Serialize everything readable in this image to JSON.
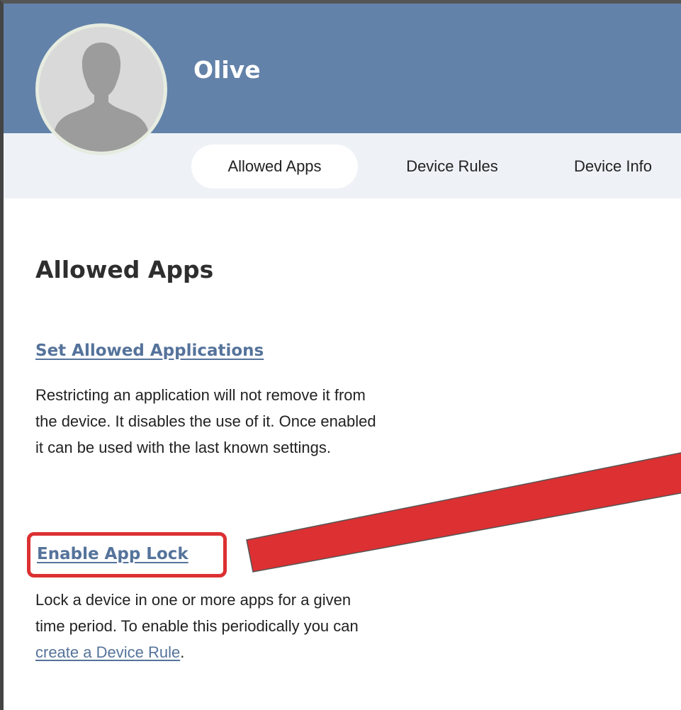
{
  "profile": {
    "name": "Olive"
  },
  "tabs": [
    {
      "label": "Allowed Apps",
      "active": true
    },
    {
      "label": "Device Rules",
      "active": false
    },
    {
      "label": "Device Info",
      "active": false
    }
  ],
  "main": {
    "title": "Allowed Apps",
    "set_allowed": {
      "link": "Set Allowed Applications",
      "description_lines": [
        "Restricting an application will not remove it from",
        "the device. It disables the use of it. Once enabled",
        "it can be used with the last known settings."
      ]
    },
    "app_lock": {
      "link": "Enable App Lock",
      "description_lines": [
        "Lock a device in one or more apps for a given",
        "time period. To enable this periodically you can"
      ],
      "inline_link": "create a Device Rule",
      "trailing": "."
    }
  },
  "annotation": {
    "highlight_color": "#dc3032",
    "arrow_color": "#dc3032"
  },
  "colors": {
    "header_bg": "#6382a9",
    "tabbar_bg": "#eef2f7",
    "link": "#55739b"
  }
}
